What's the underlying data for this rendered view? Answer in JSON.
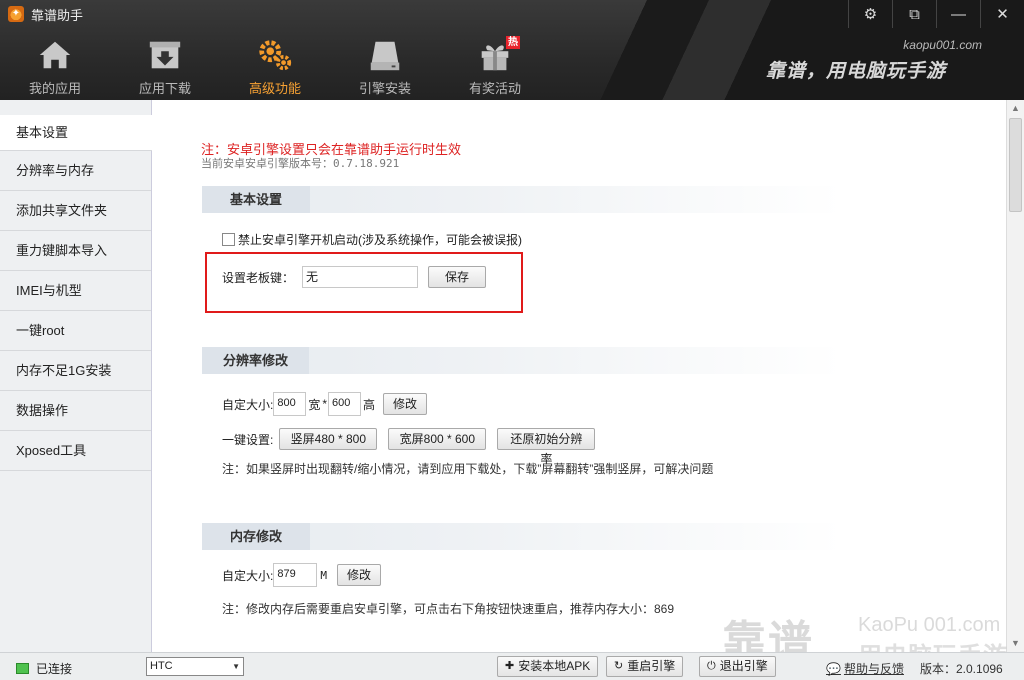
{
  "app": {
    "title": "靠谱助手",
    "brand_url": "kaopu001.com",
    "brand_slogan": "靠谱，用电脑玩手游"
  },
  "nav": {
    "items": [
      {
        "label": "我的应用",
        "icon": "home-icon"
      },
      {
        "label": "应用下载",
        "icon": "download-box-icon"
      },
      {
        "label": "高级功能",
        "icon": "gears-icon",
        "active": true
      },
      {
        "label": "引擎安装",
        "icon": "disk-icon"
      },
      {
        "label": "有奖活动",
        "icon": "gift-icon",
        "badge": "热"
      }
    ]
  },
  "sidebar": {
    "items": [
      {
        "label": "基本设置",
        "active": true
      },
      {
        "label": "分辨率与内存"
      },
      {
        "label": "添加共享文件夹"
      },
      {
        "label": "重力键脚本导入"
      },
      {
        "label": "IMEI与机型"
      },
      {
        "label": "一键root"
      },
      {
        "label": "内存不足1G安装"
      },
      {
        "label": "数据操作"
      },
      {
        "label": "Xposed工具"
      }
    ]
  },
  "main": {
    "notice": "注：安卓引擎设置只会在靠谱助手运行时生效",
    "version_line": "当前安卓安卓引擎版本号：0.7.18.921",
    "basic": {
      "title": "基本设置",
      "checkbox_label": "禁止安卓引擎开机启动(涉及系统操作，可能会被误报)",
      "bosskey_label": "设置老板键：",
      "bosskey_value": "无",
      "save_label": "保存"
    },
    "resolution": {
      "title": "分辨率修改",
      "custom_label": "自定大小:",
      "width_value": "800",
      "width_unit": "宽",
      "times": "*",
      "height_value": "600",
      "height_unit": "高",
      "modify_label": "修改",
      "oneclick_label": "一键设置:",
      "portrait_label": "竖屏480 * 800",
      "landscape_label": "宽屏800 * 600",
      "restore_label": "还原初始分辨率",
      "note": "注：如果竖屏时出现翻转/缩小情况，请到应用下载处，下载”屏幕翻转”强制竖屏，可解决问题"
    },
    "memory": {
      "title": "内存修改",
      "custom_label": "自定大小:",
      "value": "879",
      "unit": "M",
      "modify_label": "修改",
      "note": "注：修改内存后需要重启安卓引擎，可点击右下角按钮快速重启，推荐内存大小：869"
    }
  },
  "statusbar": {
    "connection": "已连接",
    "device": "HTC",
    "install_apk": "安装本地APK",
    "restart_engine": "重启引擎",
    "exit_engine": "退出引擎",
    "help": "帮助与反馈",
    "version": "版本：2.0.1096"
  },
  "watermark": {
    "big": "靠谱",
    "url": "KaoPu 001.com",
    "sub": "用电脑玩手游"
  }
}
